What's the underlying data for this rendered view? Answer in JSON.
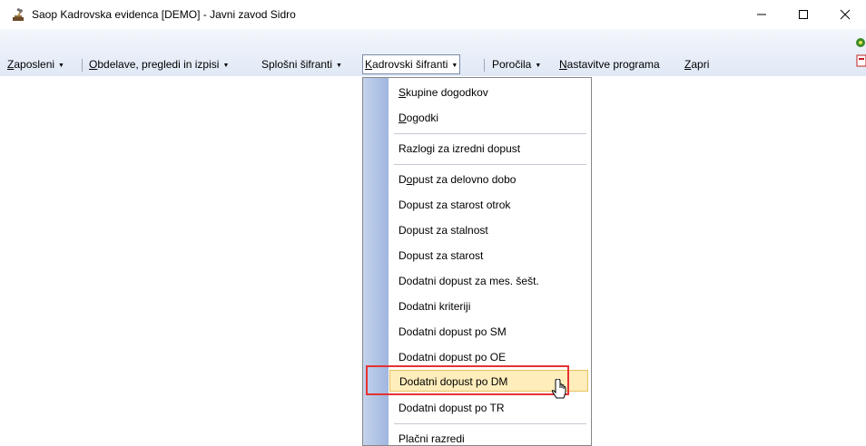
{
  "window": {
    "title": "Saop Kadrovska evidenca  [DEMO] - Javni zavod Sidro",
    "app_icon": "hammer-anvil-icon",
    "controls": [
      "minimize-icon",
      "maximize-icon",
      "close-icon"
    ]
  },
  "menubar": {
    "items": [
      {
        "pre": "",
        "u": "Z",
        "post": "aposleni"
      },
      {
        "pre": "",
        "u": "O",
        "post": "bdelave, pregledi in izpisi"
      },
      {
        "pre": "",
        "u": "",
        "post": "Splošni šifranti"
      },
      {
        "pre": "",
        "u": "K",
        "post": "adrovski šifranti"
      },
      {
        "pre": "",
        "u": "",
        "post": "Poročila"
      },
      {
        "pre": "",
        "u": "N",
        "post": "astavitve programa"
      },
      {
        "pre": "",
        "u": "Z",
        "post": "apri"
      }
    ],
    "open_menu": "Kadrovski šifranti"
  },
  "dropdown": {
    "items": [
      {
        "pre": "",
        "u": "S",
        "post": "kupine dogodkov"
      },
      {
        "pre": "",
        "u": "D",
        "post": "ogodki"
      },
      {
        "pre": "Razlogi za izredni dopust",
        "u": "",
        "post": ""
      },
      {
        "pre": "D",
        "u": "o",
        "post": "pust za delovno dobo"
      },
      {
        "pre": "Dopust za starost otrok",
        "u": "",
        "post": ""
      },
      {
        "pre": "Dopust za stalnost",
        "u": "",
        "post": ""
      },
      {
        "pre": "Dopust za starost",
        "u": "",
        "post": ""
      },
      {
        "pre": "Dodatni dopust za mes. šešt.",
        "u": "",
        "post": ""
      },
      {
        "pre": "Dodatni kriteriji",
        "u": "",
        "post": ""
      },
      {
        "pre": "Dodatni dopust po SM",
        "u": "",
        "post": ""
      },
      {
        "pre": "Dodatni dopust po OE",
        "u": "",
        "post": ""
      },
      {
        "pre": "Dodatni dopust po DM",
        "u": "",
        "post": ""
      },
      {
        "pre": "Dodatni dopust po TR",
        "u": "",
        "post": ""
      },
      {
        "pre": "Plačni razredi",
        "u": "",
        "post": ""
      }
    ],
    "hovered": "Dodatni dopust po DM"
  },
  "colors": {
    "menubar_gradient": [
      "#f4f7fc",
      "#dfe8f5"
    ],
    "hover_bg": "#ffedbb",
    "annotation_box": "#e53232"
  }
}
